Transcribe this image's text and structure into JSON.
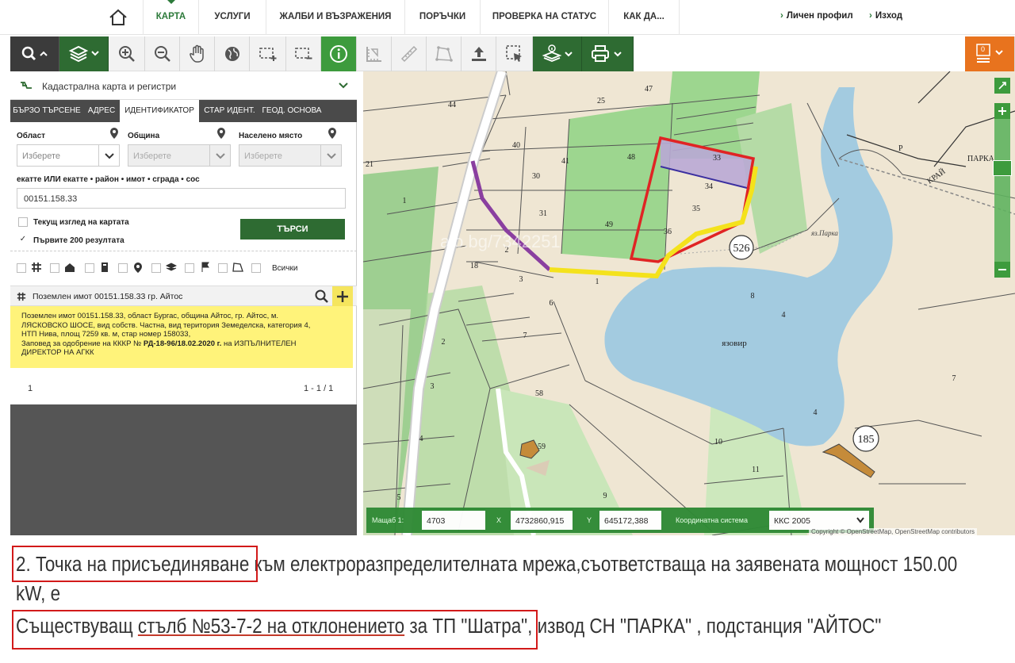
{
  "nav": {
    "items": [
      "КАРТА",
      "УСЛУГИ",
      "ЖАЛБИ И ВЪЗРАЖЕНИЯ",
      "ПОРЪЧКИ",
      "ПРОВЕРКА НА СТАТУС",
      "КАК ДА..."
    ],
    "profile_label": "Личен профил",
    "logout_label": "Изход"
  },
  "toolbar": {
    "cart_count": "0"
  },
  "panel": {
    "layer_label": "Кадастрална карта и регистри",
    "tabs": [
      "БЪРЗО ТЪРСЕНЕ",
      "АДРЕС",
      "ИДЕНТИФИКАТОР",
      "СТАР ИДЕНТ.",
      "ГЕОД. ОСНОВА"
    ],
    "oblast_label": "Област",
    "obshtina_label": "Община",
    "naseleno_label": "Населено място",
    "select_placeholder": "Изберете",
    "identifier_label": "екатте ИЛИ екатте • район • имот • сграда • сос",
    "identifier_value": "00151.158.33",
    "chk_current_view": "Текущ изглед на картата",
    "chk_first_200": "Първите 200 резултата",
    "search_button": "ТЪРСИ",
    "filter_all": "Всички",
    "result_title": "Поземлен имот 00151.158.33 гр. Айтос",
    "result_line1": "Поземлен имот 00151.158.33, област Бургас, община Айтос, гр. Айтос, м.",
    "result_line2": "ЛЯСКОВСКО ШОСЕ, вид собств. Частна, вид територия Земеделска, категория 4,",
    "result_line3": "НТП Нива, площ 7259 кв. м, стар номер 158033,",
    "result_line4a": "Заповед за одобрение на КККР № ",
    "result_line4b": "РД-18-96/18.02.2020 г.",
    "result_line4c": " на ИЗПЪЛНИТЕЛЕН",
    "result_line5": "ДИРЕКТОР НА АГКК",
    "pager_page": "1",
    "pager_range": "1 - 1 / 1"
  },
  "map": {
    "parcels": [
      "44",
      "25",
      "47",
      "40",
      "41",
      "48",
      "33",
      "34",
      "35",
      "21",
      "30",
      "31",
      "1",
      "49",
      "36",
      "2",
      "18",
      "3",
      "1",
      "6",
      "7",
      "2",
      "3",
      "4",
      "58",
      "5",
      "59",
      "10",
      "11",
      "9",
      "8",
      "4",
      "7",
      "4"
    ],
    "labels": {
      "reservoir": "язовир",
      "reservoir_name": "яз.Парка",
      "road1": "КРАЙ",
      "road2": "ПАРКА",
      "circle1": "526",
      "circle2": "185"
    },
    "watermark": "alo.bg/7342251",
    "attribution": "Copyright © OpenStreetMap, OpenStreetMap contributors"
  },
  "coords": {
    "scale_label": "Мащаб 1:",
    "scale_value": "4703",
    "x_label": "X",
    "x_value": "4732860,915",
    "y_label": "Y",
    "y_value": "645172,388",
    "system_label": "Координатна система",
    "system_value": "ККС 2005"
  },
  "note": {
    "line1a": "2. Точка на присъединяване",
    "line1b": " към електроразпределителната мрежа,съответстваща на заявената мощност 150.00",
    "line2": "kW, е",
    "line3a": "Съществуващ ",
    "line3b": "стълб №53-7-2 на отклонението",
    "line3c": " за ТП \"Шатра\"",
    "line3d": ", извод СН \"ПАРКА\" , подстанция \"АЙТОС\""
  }
}
